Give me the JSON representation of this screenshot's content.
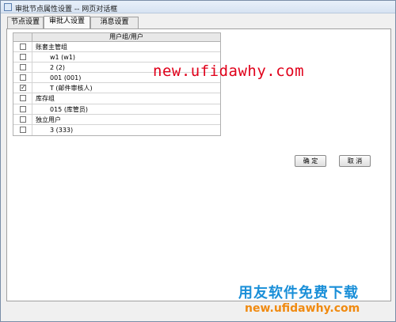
{
  "window": {
    "title": "审批节点属性设置 -- 网页对话框"
  },
  "tabs": [
    {
      "label": "节点设置"
    },
    {
      "label": "审批人设置"
    },
    {
      "label": "消息设置"
    }
  ],
  "grid": {
    "header": "用户组/用户",
    "rows": [
      {
        "label": "账套主管组",
        "checked": false,
        "kind": "group"
      },
      {
        "label": "w1 (w1)",
        "checked": false,
        "kind": "user"
      },
      {
        "label": "2 (2)",
        "checked": false,
        "kind": "user"
      },
      {
        "label": "001 (001)",
        "checked": false,
        "kind": "user"
      },
      {
        "label": "T (邮件审核人)",
        "checked": true,
        "kind": "user"
      },
      {
        "label": "库存组",
        "checked": false,
        "kind": "group"
      },
      {
        "label": "015 (库管员)",
        "checked": false,
        "kind": "user"
      },
      {
        "label": "独立用户",
        "checked": false,
        "kind": "group"
      },
      {
        "label": "3 (333)",
        "checked": false,
        "kind": "user"
      }
    ]
  },
  "buttons": {
    "ok": "确 定",
    "cancel": "取 消"
  },
  "watermark": {
    "url": "new.ufidawhy.com"
  },
  "logo": {
    "name": "用友软件免费下载",
    "url": "new.ufidawhy.com"
  },
  "checkbox_mark": "✓"
}
